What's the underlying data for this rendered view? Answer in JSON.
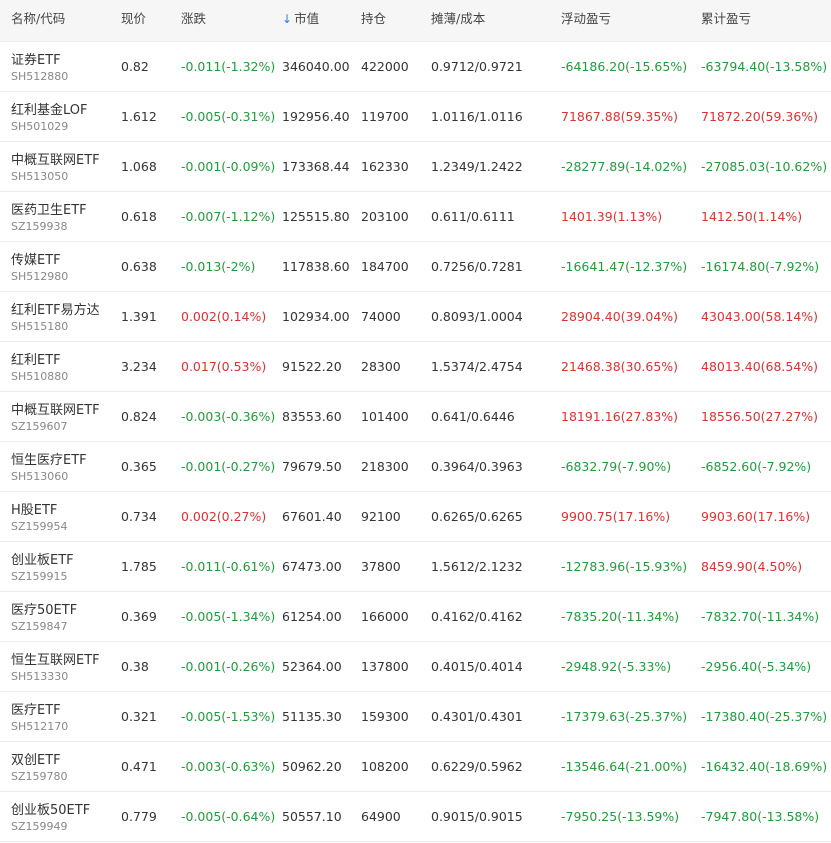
{
  "header": {
    "name_code": "名称/代码",
    "price": "现价",
    "change": "涨跌",
    "market_value": "市值",
    "position": "持仓",
    "cost": "摊薄/成本",
    "floating_pnl": "浮动盈亏",
    "cumulative_pnl": "累计盈亏",
    "sort_arrow": "↓"
  },
  "colors": {
    "up": "#e03131",
    "down": "#1f9d3a",
    "sort_arrow": "#2b7de9"
  },
  "rows": [
    {
      "name": "证券ETF",
      "code": "SH512880",
      "price": "0.82",
      "change": "-0.011(-1.32%)",
      "change_dir": "down",
      "market_value": "346040.00",
      "position": "422000",
      "cost": "0.9712/0.9721",
      "float_pnl": "-64186.20(-15.65%)",
      "float_dir": "down",
      "total_pnl": "-63794.40(-13.58%)",
      "total_dir": "down"
    },
    {
      "name": "红利基金LOF",
      "code": "SH501029",
      "price": "1.612",
      "change": "-0.005(-0.31%)",
      "change_dir": "down",
      "market_value": "192956.40",
      "position": "119700",
      "cost": "1.0116/1.0116",
      "float_pnl": "71867.88(59.35%)",
      "float_dir": "up",
      "total_pnl": "71872.20(59.36%)",
      "total_dir": "up"
    },
    {
      "name": "中概互联网ETF",
      "code": "SH513050",
      "price": "1.068",
      "change": "-0.001(-0.09%)",
      "change_dir": "down",
      "market_value": "173368.44",
      "position": "162330",
      "cost": "1.2349/1.2422",
      "float_pnl": "-28277.89(-14.02%)",
      "float_dir": "down",
      "total_pnl": "-27085.03(-10.62%)",
      "total_dir": "down"
    },
    {
      "name": "医药卫生ETF",
      "code": "SZ159938",
      "price": "0.618",
      "change": "-0.007(-1.12%)",
      "change_dir": "down",
      "market_value": "125515.80",
      "position": "203100",
      "cost": "0.611/0.6111",
      "float_pnl": "1401.39(1.13%)",
      "float_dir": "up",
      "total_pnl": "1412.50(1.14%)",
      "total_dir": "up"
    },
    {
      "name": "传媒ETF",
      "code": "SH512980",
      "price": "0.638",
      "change": "-0.013(-2%)",
      "change_dir": "down",
      "market_value": "117838.60",
      "position": "184700",
      "cost": "0.7256/0.7281",
      "float_pnl": "-16641.47(-12.37%)",
      "float_dir": "down",
      "total_pnl": "-16174.80(-7.92%)",
      "total_dir": "down"
    },
    {
      "name": "红利ETF易方达",
      "code": "SH515180",
      "price": "1.391",
      "change": "0.002(0.14%)",
      "change_dir": "up",
      "market_value": "102934.00",
      "position": "74000",
      "cost": "0.8093/1.0004",
      "float_pnl": "28904.40(39.04%)",
      "float_dir": "up",
      "total_pnl": "43043.00(58.14%)",
      "total_dir": "up"
    },
    {
      "name": "红利ETF",
      "code": "SH510880",
      "price": "3.234",
      "change": "0.017(0.53%)",
      "change_dir": "up",
      "market_value": "91522.20",
      "position": "28300",
      "cost": "1.5374/2.4754",
      "float_pnl": "21468.38(30.65%)",
      "float_dir": "up",
      "total_pnl": "48013.40(68.54%)",
      "total_dir": "up"
    },
    {
      "name": "中概互联网ETF",
      "code": "SZ159607",
      "price": "0.824",
      "change": "-0.003(-0.36%)",
      "change_dir": "down",
      "market_value": "83553.60",
      "position": "101400",
      "cost": "0.641/0.6446",
      "float_pnl": "18191.16(27.83%)",
      "float_dir": "up",
      "total_pnl": "18556.50(27.27%)",
      "total_dir": "up"
    },
    {
      "name": "恒生医疗ETF",
      "code": "SH513060",
      "price": "0.365",
      "change": "-0.001(-0.27%)",
      "change_dir": "down",
      "market_value": "79679.50",
      "position": "218300",
      "cost": "0.3964/0.3963",
      "float_pnl": "-6832.79(-7.90%)",
      "float_dir": "down",
      "total_pnl": "-6852.60(-7.92%)",
      "total_dir": "down"
    },
    {
      "name": "H股ETF",
      "code": "SZ159954",
      "price": "0.734",
      "change": "0.002(0.27%)",
      "change_dir": "up",
      "market_value": "67601.40",
      "position": "92100",
      "cost": "0.6265/0.6265",
      "float_pnl": "9900.75(17.16%)",
      "float_dir": "up",
      "total_pnl": "9903.60(17.16%)",
      "total_dir": "up"
    },
    {
      "name": "创业板ETF",
      "code": "SZ159915",
      "price": "1.785",
      "change": "-0.011(-0.61%)",
      "change_dir": "down",
      "market_value": "67473.00",
      "position": "37800",
      "cost": "1.5612/2.1232",
      "float_pnl": "-12783.96(-15.93%)",
      "float_dir": "down",
      "total_pnl": "8459.90(4.50%)",
      "total_dir": "up"
    },
    {
      "name": "医疗50ETF",
      "code": "SZ159847",
      "price": "0.369",
      "change": "-0.005(-1.34%)",
      "change_dir": "down",
      "market_value": "61254.00",
      "position": "166000",
      "cost": "0.4162/0.4162",
      "float_pnl": "-7835.20(-11.34%)",
      "float_dir": "down",
      "total_pnl": "-7832.70(-11.34%)",
      "total_dir": "down"
    },
    {
      "name": "恒生互联网ETF",
      "code": "SH513330",
      "price": "0.38",
      "change": "-0.001(-0.26%)",
      "change_dir": "down",
      "market_value": "52364.00",
      "position": "137800",
      "cost": "0.4015/0.4014",
      "float_pnl": "-2948.92(-5.33%)",
      "float_dir": "down",
      "total_pnl": "-2956.40(-5.34%)",
      "total_dir": "down"
    },
    {
      "name": "医疗ETF",
      "code": "SH512170",
      "price": "0.321",
      "change": "-0.005(-1.53%)",
      "change_dir": "down",
      "market_value": "51135.30",
      "position": "159300",
      "cost": "0.4301/0.4301",
      "float_pnl": "-17379.63(-25.37%)",
      "float_dir": "down",
      "total_pnl": "-17380.40(-25.37%)",
      "total_dir": "down"
    },
    {
      "name": "双创ETF",
      "code": "SZ159780",
      "price": "0.471",
      "change": "-0.003(-0.63%)",
      "change_dir": "down",
      "market_value": "50962.20",
      "position": "108200",
      "cost": "0.6229/0.5962",
      "float_pnl": "-13546.64(-21.00%)",
      "float_dir": "down",
      "total_pnl": "-16432.40(-18.69%)",
      "total_dir": "down"
    },
    {
      "name": "创业板50ETF",
      "code": "SZ159949",
      "price": "0.779",
      "change": "-0.005(-0.64%)",
      "change_dir": "down",
      "market_value": "50557.10",
      "position": "64900",
      "cost": "0.9015/0.9015",
      "float_pnl": "-7950.25(-13.59%)",
      "float_dir": "down",
      "total_pnl": "-7947.80(-13.58%)",
      "total_dir": "down"
    }
  ]
}
